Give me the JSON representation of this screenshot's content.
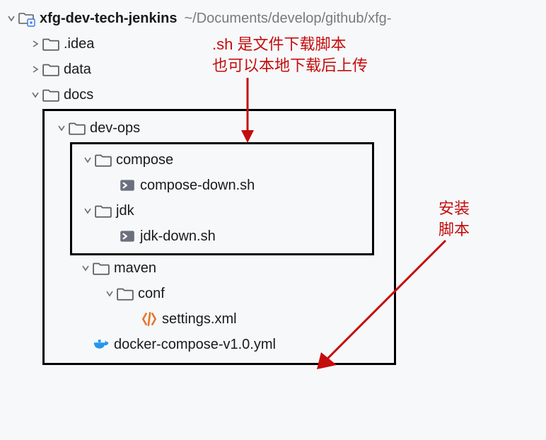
{
  "root": {
    "name": "xfg-dev-tech-jenkins",
    "path": "~/Documents/develop/github/xfg-"
  },
  "nodes": {
    "idea": ".idea",
    "data": "data",
    "docs": "docs",
    "devops": "dev-ops",
    "compose": "compose",
    "composeDown": "compose-down.sh",
    "jdk": "jdk",
    "jdkDown": "jdk-down.sh",
    "maven": "maven",
    "conf": "conf",
    "settings": "settings.xml",
    "dockerCompose": "docker-compose-v1.0.yml"
  },
  "annotations": {
    "top1": ".sh 是文件下载脚本",
    "top2": "也可以本地下载后上传",
    "right1": "安装",
    "right2": "脚本"
  }
}
